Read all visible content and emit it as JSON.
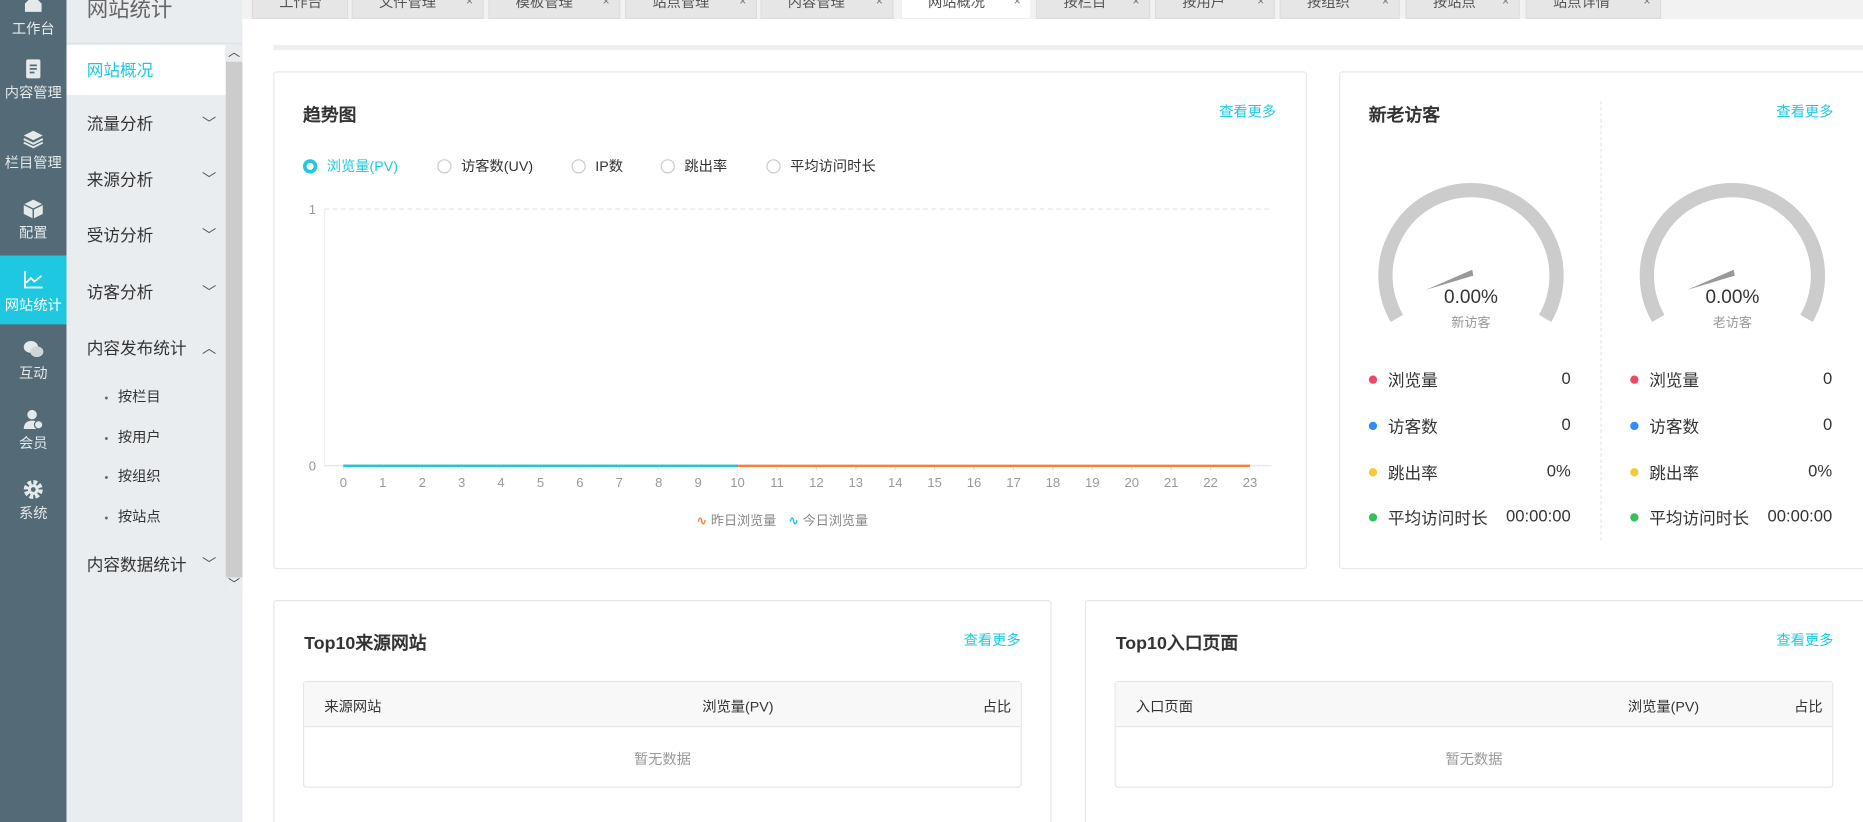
{
  "iconbar": [
    {
      "label": "工作台",
      "icon": "home-icon"
    },
    {
      "label": "内容管理",
      "icon": "document-icon"
    },
    {
      "label": "栏目管理",
      "icon": "layers-icon"
    },
    {
      "label": "配置",
      "icon": "box-icon"
    },
    {
      "label": "网站统计",
      "icon": "chart-line-icon",
      "active": true
    },
    {
      "label": "互动",
      "icon": "chat-icon"
    },
    {
      "label": "会员",
      "icon": "user-icon"
    },
    {
      "label": "系统",
      "icon": "gear-icon"
    }
  ],
  "sidebar": {
    "title": "网站统计",
    "items": [
      {
        "label": "网站概况",
        "active": true
      },
      {
        "label": "流量分析"
      },
      {
        "label": "来源分析"
      },
      {
        "label": "受访分析"
      },
      {
        "label": "访客分析"
      },
      {
        "label": "内容发布统计",
        "expanded": true
      },
      {
        "label": "内容数据统计"
      }
    ],
    "subitems": [
      "按栏目",
      "按用户",
      "按组织",
      "按站点"
    ]
  },
  "tabs": [
    {
      "label": "工作台",
      "closable": false
    },
    {
      "label": "文件管理"
    },
    {
      "label": "模板管理"
    },
    {
      "label": "站点管理"
    },
    {
      "label": "内容管理"
    },
    {
      "label": "网站概况",
      "active": true
    },
    {
      "label": "按栏目"
    },
    {
      "label": "按用户"
    },
    {
      "label": "按组织"
    },
    {
      "label": "按站点"
    },
    {
      "label": "站点详情"
    }
  ],
  "close_glyph": "×",
  "more_label": "查看更多",
  "trend": {
    "title": "趋势图",
    "radios": [
      "浏览量(PV)",
      "访客数(UV)",
      "IP数",
      "跳出率",
      "平均访问时长"
    ],
    "selected": 0
  },
  "chart_data": {
    "type": "line",
    "x": [
      0,
      1,
      2,
      3,
      4,
      5,
      6,
      7,
      8,
      9,
      10,
      11,
      12,
      13,
      14,
      15,
      16,
      17,
      18,
      19,
      20,
      21,
      22,
      23
    ],
    "x_labels": [
      "0",
      "1",
      "2",
      "3",
      "4",
      "5",
      "6",
      "7",
      "8",
      "9",
      "10",
      "11",
      "12",
      "13",
      "14",
      "15",
      "16",
      "17",
      "18",
      "19",
      "20",
      "21",
      "22",
      "23"
    ],
    "y_labels": [
      "1",
      "0"
    ],
    "ylim": [
      0,
      1
    ],
    "series": [
      {
        "name": "昨日浏览量",
        "color": "#f5803e",
        "values": [
          0,
          0,
          0,
          0,
          0,
          0,
          0,
          0,
          0,
          0,
          0,
          0,
          0,
          0,
          0,
          0,
          0,
          0,
          0,
          0,
          0,
          0,
          0,
          0
        ]
      },
      {
        "name": "今日浏览量",
        "color": "#1ec8e1",
        "values": [
          0,
          0,
          0,
          0,
          0,
          0,
          0,
          0,
          0,
          0,
          0
        ]
      }
    ],
    "legend": "bottom-center"
  },
  "visitors": {
    "title": "新老访客",
    "groups": [
      {
        "gauge_value": "0.00%",
        "gauge_label": "新访客",
        "fraction": 0,
        "stats": [
          {
            "label": "浏览量",
            "value": "0"
          },
          {
            "label": "访客数",
            "value": "0"
          },
          {
            "label": "跳出率",
            "value": "0%"
          },
          {
            "label": "平均访问时长",
            "value": "00:00:00"
          }
        ]
      },
      {
        "gauge_value": "0.00%",
        "gauge_label": "老访客",
        "fraction": 0,
        "stats": [
          {
            "label": "浏览量",
            "value": "0"
          },
          {
            "label": "访客数",
            "value": "0"
          },
          {
            "label": "跳出率",
            "value": "0%"
          },
          {
            "label": "平均访问时长",
            "value": "00:00:00"
          }
        ]
      }
    ],
    "dot_colors": [
      "#ee4866",
      "#2f8ff5",
      "#f8c932",
      "#34c15c"
    ]
  },
  "sources": {
    "title": "Top10来源网站",
    "columns": [
      "来源网站",
      "浏览量(PV)",
      "占比"
    ],
    "empty": "暂无数据"
  },
  "entries": {
    "title": "Top10入口页面",
    "columns": [
      "入口页面",
      "浏览量(PV)",
      "占比"
    ],
    "empty": "暂无数据"
  }
}
